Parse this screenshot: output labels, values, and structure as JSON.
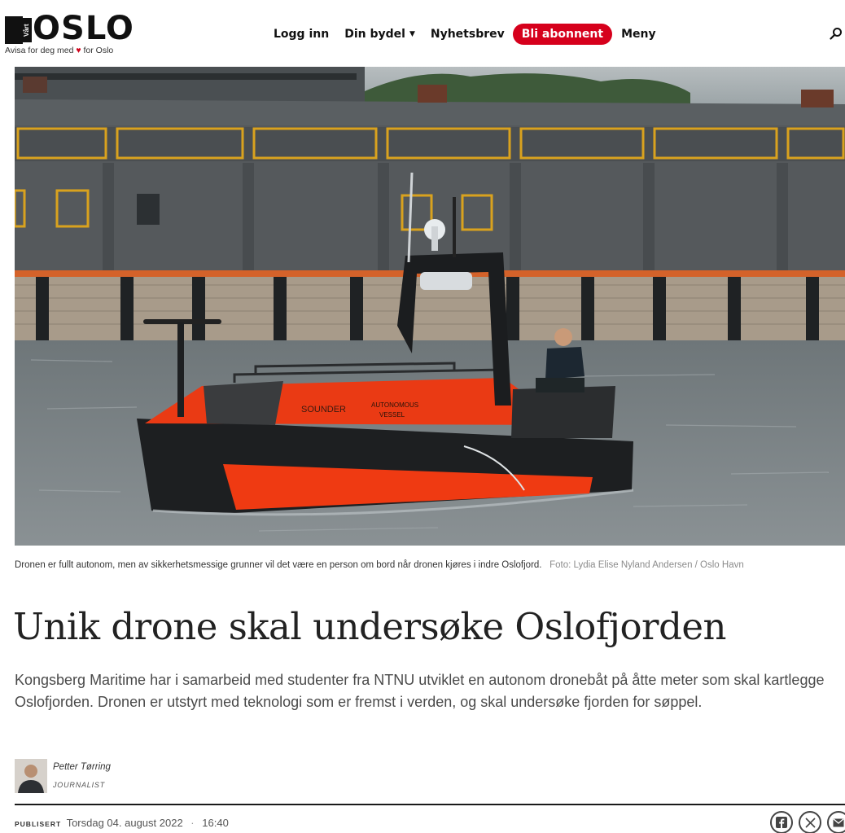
{
  "header": {
    "logo_vertical": "Vårt",
    "logo_word": "OSLO",
    "tagline_pre": "Avisa for deg med",
    "tagline_heart": "♥",
    "tagline_post": "for Oslo",
    "nav": {
      "login": "Logg inn",
      "district": "Din bydel",
      "district_caret": "▼",
      "newsletter": "Nyhetsbrev",
      "subscribe": "Bli abonnent",
      "menu": "Meny"
    },
    "colors": {
      "accent": "#d6001c"
    }
  },
  "photo": {
    "alt": "Orange autonomous drone boat with a person on board in front of a grey harbour building"
  },
  "caption": {
    "text": "Dronen er fullt autonom, men av sikkerhetsmessige grunner vil det være en person om bord når dronen kjøres i indre Oslofjord.",
    "credit": "Foto: Lydia Elise Nyland Andersen / Oslo Havn"
  },
  "article": {
    "headline": "Unik drone skal undersøke Oslofjorden",
    "lead": "Kongsberg Maritime har i samarbeid med studenter fra NTNU utviklet en autonom dronebåt på åtte meter som skal kartlegge Oslofjorden. Dronen er utstyrt med teknologi som er fremst i verden, og skal undersøke fjorden for søppel."
  },
  "byline": {
    "name": "Petter Tørring",
    "role": "JOURNALIST"
  },
  "published": {
    "label": "PUBLISERT",
    "date": "Torsdag 04. august 2022",
    "separator": "·",
    "time": "16:40"
  },
  "share": {
    "icons": [
      "facebook-icon",
      "x-icon",
      "email-icon"
    ]
  }
}
